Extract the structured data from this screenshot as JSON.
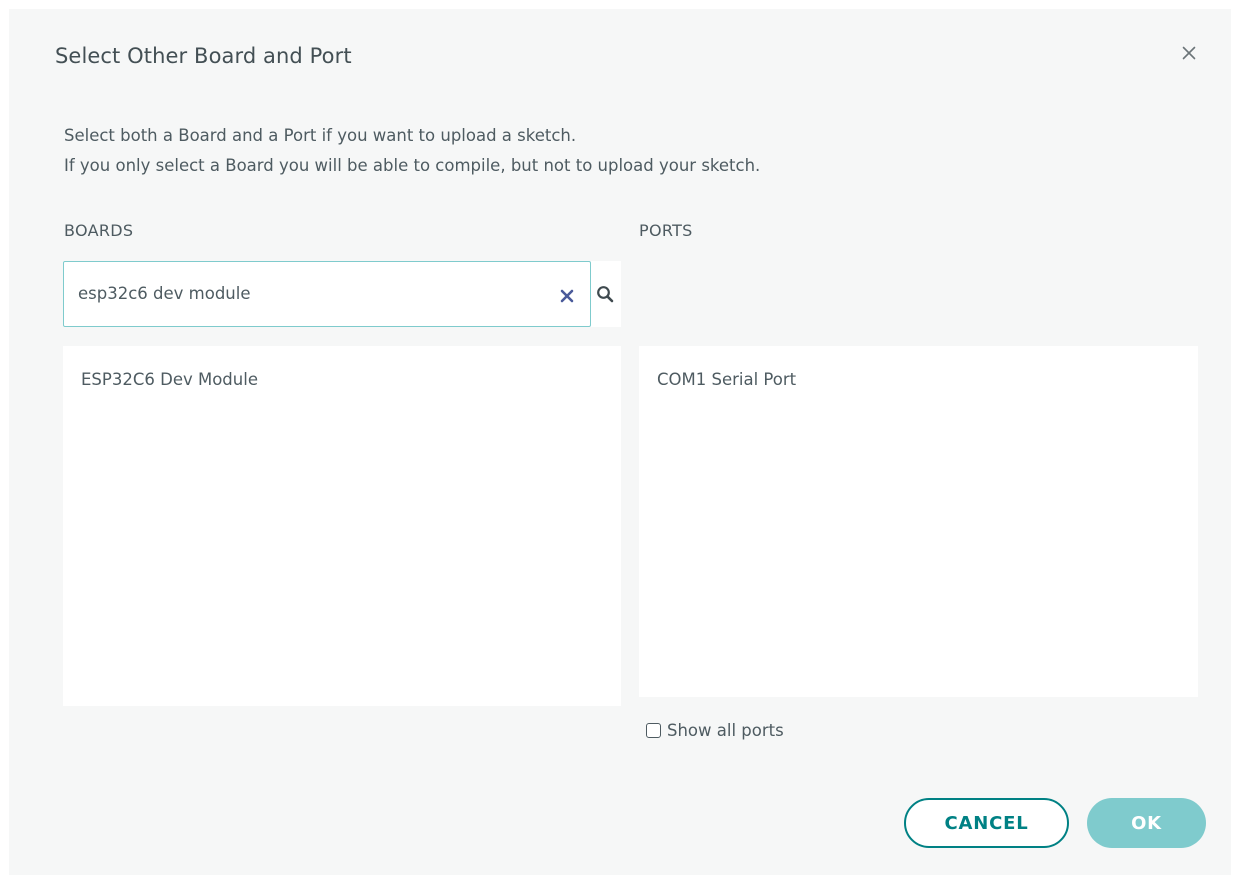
{
  "dialog": {
    "title": "Select Other Board and Port",
    "close_icon": "close-icon",
    "description": [
      "Select both a Board and a Port if you want to upload a sketch.",
      "If you only select a Board you will be able to compile, but not to upload your sketch."
    ]
  },
  "boards": {
    "label": "BOARDS",
    "search": {
      "value": "esp32c6 dev module",
      "clear_icon": "clear-icon",
      "search_icon": "search-icon"
    },
    "items": [
      {
        "label": "ESP32C6 Dev Module"
      }
    ]
  },
  "ports": {
    "label": "PORTS",
    "items": [
      {
        "label": "COM1 Serial Port"
      }
    ],
    "show_all_label": "Show all ports",
    "show_all_checked": false
  },
  "buttons": {
    "cancel_label": "CANCEL",
    "ok_label": "OK"
  },
  "colors": {
    "dialog_background": "#f6f7f7",
    "accent": "#008184",
    "accent_light": "#7fcbcd",
    "text": "#4e5b61",
    "clear_icon": "#4a5a9a"
  }
}
